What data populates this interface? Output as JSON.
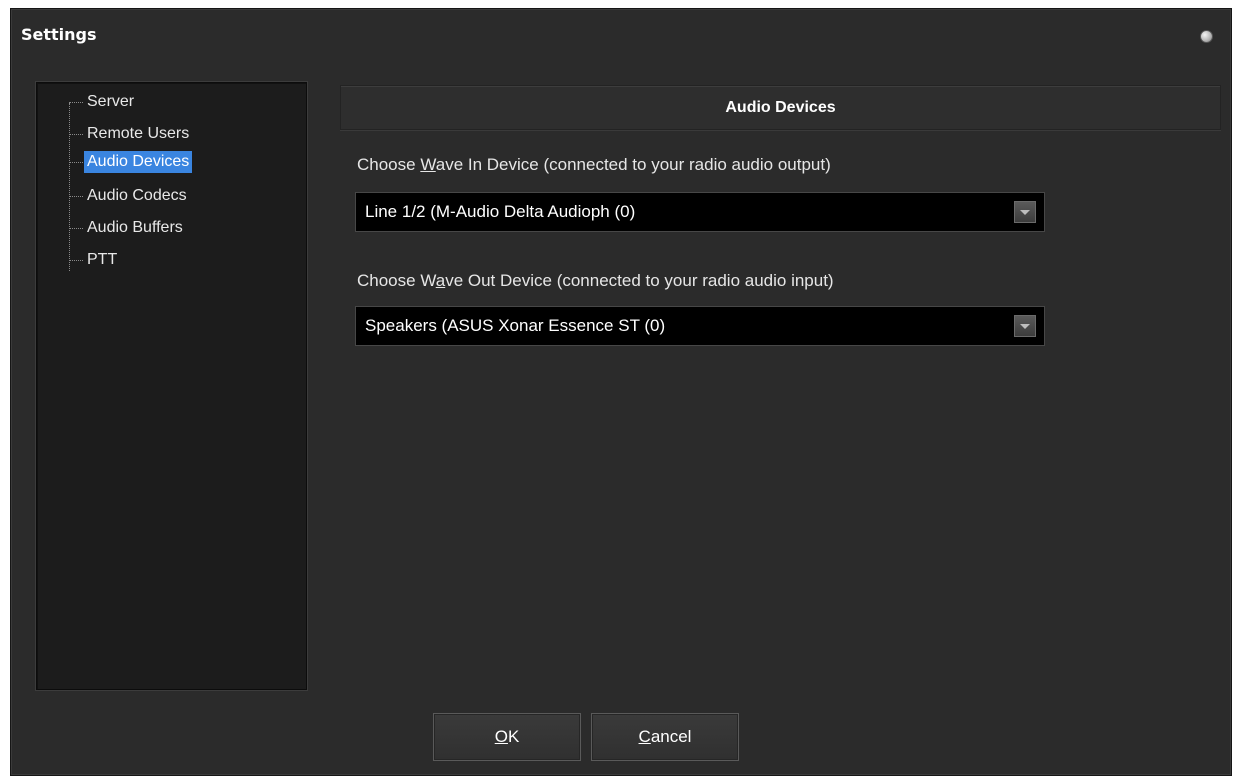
{
  "window": {
    "title": "Settings"
  },
  "tree": {
    "items": [
      {
        "label": "Server"
      },
      {
        "label": "Remote Users"
      },
      {
        "label": "Audio Devices",
        "selected": true
      },
      {
        "label": "Audio Codecs"
      },
      {
        "label": "Audio Buffers"
      },
      {
        "label": "PTT"
      }
    ]
  },
  "panel": {
    "header": "Audio Devices",
    "wave_in": {
      "label_pre": "Choose ",
      "label_mnemonic": "W",
      "label_post": "ave In Device (connected to your radio audio output)",
      "value": "Line 1/2 (M-Audio Delta Audioph (0)"
    },
    "wave_out": {
      "label_pre": "Choose W",
      "label_mnemonic": "a",
      "label_post": "ve Out Device (connected to your radio audio input)",
      "value": "Speakers (ASUS Xonar Essence ST (0)"
    }
  },
  "buttons": {
    "ok_mnemonic": "O",
    "ok_rest": "K",
    "cancel_mnemonic": "C",
    "cancel_rest": "ancel"
  },
  "colors": {
    "background": "#2b2b2b",
    "selection": "#3a85e0",
    "combo_background": "#000000"
  }
}
